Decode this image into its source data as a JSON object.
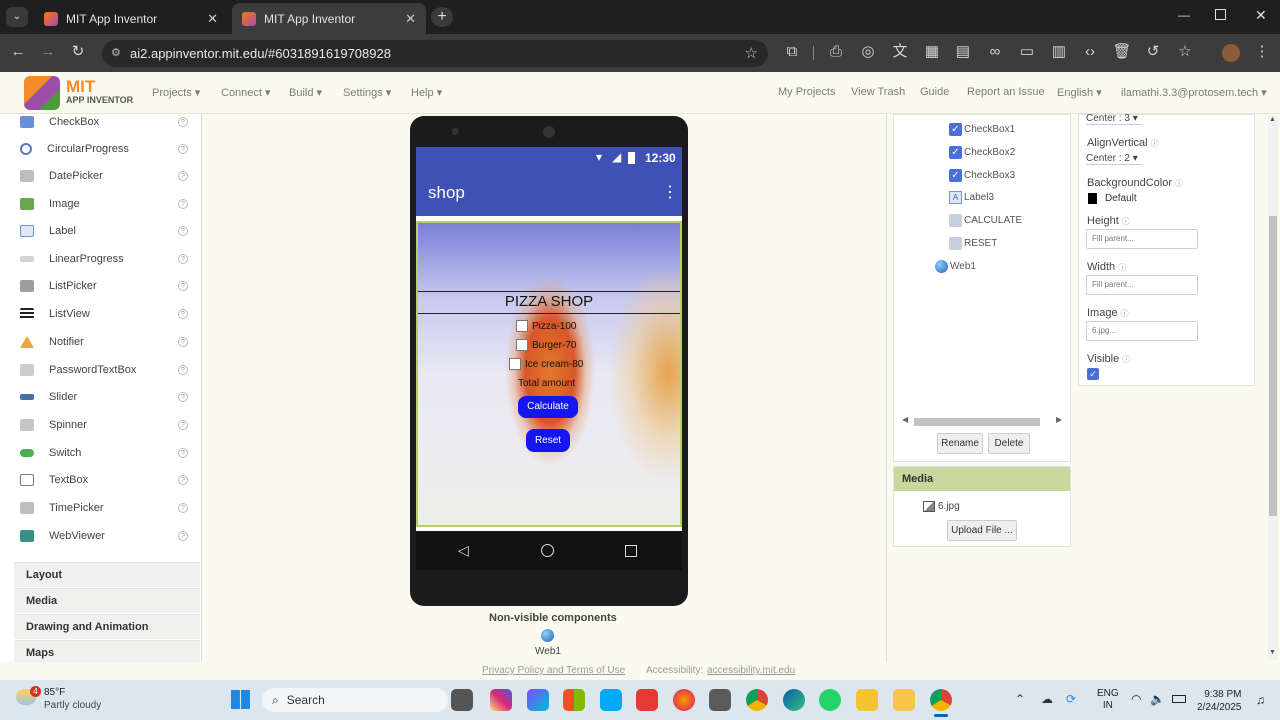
{
  "browser": {
    "tabs": [
      {
        "title": "MIT App Inventor"
      },
      {
        "title": "MIT App Inventor"
      }
    ],
    "url": "ai2.appinventor.mit.edu/#6031891619708928"
  },
  "header": {
    "logo_top": "MIT",
    "logo_bottom": "APP INVENTOR",
    "menus": [
      "Projects",
      "Connect",
      "Build",
      "Settings",
      "Help"
    ],
    "right_links": [
      "My Projects",
      "View Trash",
      "Guide",
      "Report an Issue",
      "English"
    ],
    "account": "ilamathi.3.3@protosem.tech"
  },
  "palette": {
    "items": [
      "CheckBox",
      "CircularProgress",
      "DatePicker",
      "Image",
      "Label",
      "LinearProgress",
      "ListPicker",
      "ListView",
      "Notifier",
      "PasswordTextBox",
      "Slider",
      "Spinner",
      "Switch",
      "TextBox",
      "TimePicker",
      "WebViewer"
    ],
    "categories": [
      "Layout",
      "Media",
      "Drawing and Animation",
      "Maps"
    ]
  },
  "phone": {
    "time": "12:30",
    "app_title": "shop",
    "heading": "PIZZA SHOP",
    "checkboxes": [
      "Pizza-100",
      "Burger-70",
      "Ice cream-80"
    ],
    "total_label": "Total amount",
    "calculate_button": "Calculate",
    "reset_button": "Reset"
  },
  "nonvisible": {
    "title": "Non-visible components",
    "item": "Web1"
  },
  "footer": {
    "privacy": "Privacy Policy and Terms of Use",
    "accessibility_label": "Accessibility:",
    "accessibility_link": "accessibility.mit.edu"
  },
  "components": {
    "items": [
      "CheckBox1",
      "CheckBox2",
      "CheckBox3",
      "Label3",
      "CALCULATE",
      "RESET",
      "Web1"
    ],
    "rename": "Rename",
    "delete": "Delete"
  },
  "properties": {
    "align_horizontal_value": "Center : 3",
    "align_vertical_label": "AlignVertical",
    "align_vertical_value": "Center : 2",
    "bg_label": "BackgroundColor",
    "bg_value": "Default",
    "height_label": "Height",
    "height_value": "Fill parent...",
    "width_label": "Width",
    "width_value": "Fill parent...",
    "image_label": "Image",
    "image_value": "6.jpg...",
    "visible_label": "Visible"
  },
  "media": {
    "title": "Media",
    "file": "6.jpg",
    "upload": "Upload File ..."
  },
  "taskbar": {
    "temp": "85°F",
    "weather": "Partly cloudy",
    "badge": "4",
    "search": "Search",
    "lang1": "ENG",
    "lang2": "IN",
    "time": "9:38 PM",
    "date": "2/24/2025"
  }
}
